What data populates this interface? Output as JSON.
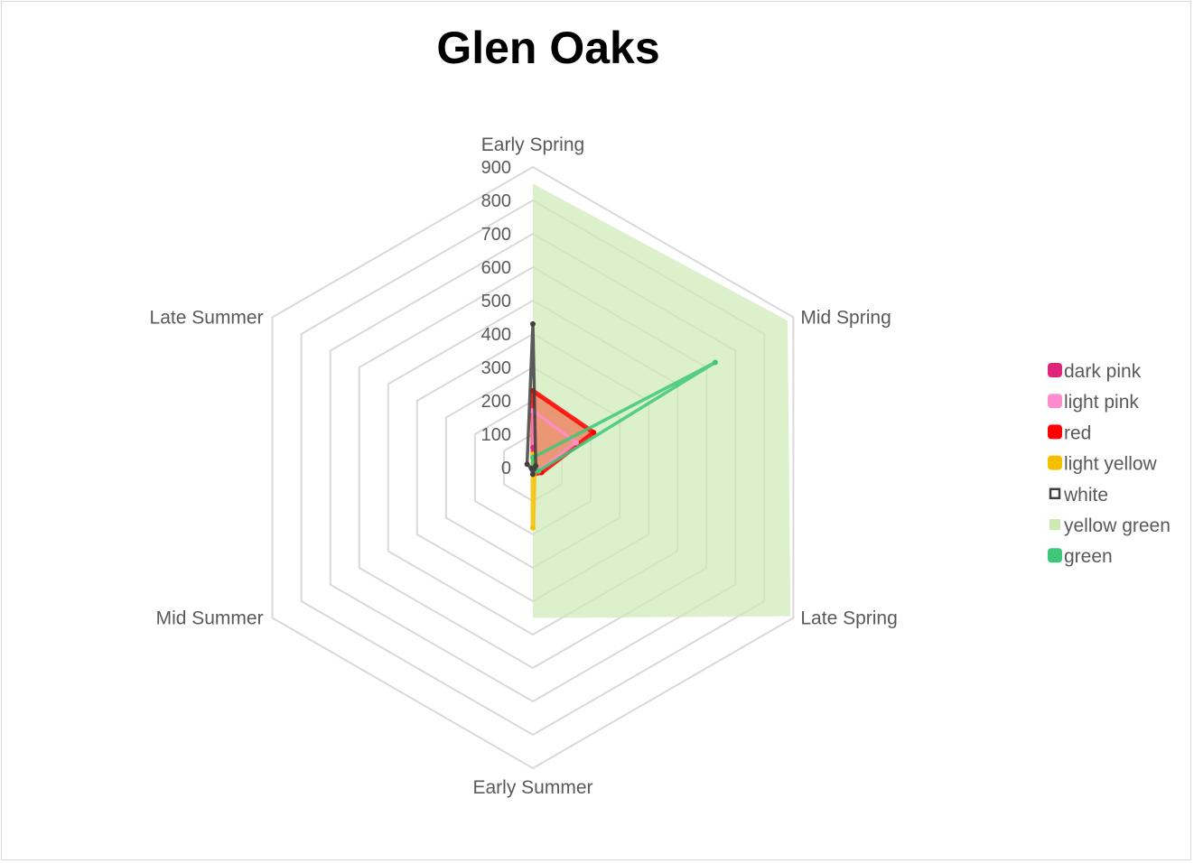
{
  "chart_data": {
    "type": "radar",
    "title": "Glen Oaks",
    "categories": [
      "Early Spring",
      "Mid Spring",
      "Late Spring",
      "Early Summer",
      "Mid Summer",
      "Late Summer"
    ],
    "rlim": [
      0,
      900
    ],
    "ticks": [
      0,
      100,
      200,
      300,
      400,
      500,
      600,
      700,
      800,
      900
    ],
    "grid": true,
    "legend_position": "right",
    "series": [
      {
        "name": "dark pink",
        "color": "#e0267a",
        "style": "line-markers",
        "values": [
          60,
          5,
          3,
          0,
          0,
          0
        ]
      },
      {
        "name": "light pink",
        "color": "#ff8ccf",
        "style": "line-markers",
        "values": [
          170,
          150,
          20,
          10,
          0,
          0
        ]
      },
      {
        "name": "red",
        "color": "#ff0000",
        "style": "line-markers-fill",
        "values": [
          230,
          210,
          30,
          20,
          0,
          0
        ]
      },
      {
        "name": "light yellow",
        "color": "#f5c000",
        "style": "line-markers",
        "values": [
          40,
          5,
          5,
          180,
          0,
          0
        ]
      },
      {
        "name": "white",
        "color": "#404040",
        "style": "line-markers",
        "values": [
          430,
          10,
          5,
          20,
          5,
          20
        ]
      },
      {
        "name": "yellow green",
        "color": "#cdeab5",
        "style": "area",
        "values": [
          850,
          880,
          890,
          450,
          0,
          0
        ]
      },
      {
        "name": "green",
        "color": "#3cc878",
        "style": "line-markers",
        "values": [
          30,
          630,
          20,
          10,
          0,
          0
        ]
      }
    ]
  }
}
